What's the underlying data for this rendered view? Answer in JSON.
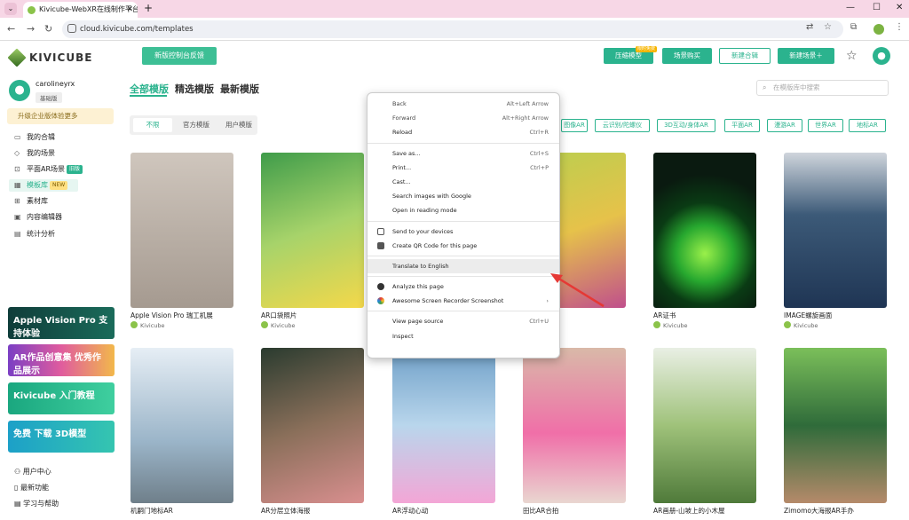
{
  "browser": {
    "tab_title": "Kivicube-WebXR在线制作平台",
    "url": "cloud.kivicube.com/templates"
  },
  "header": {
    "logo": "KIVICUBE",
    "feedback": "新版控制台反馈",
    "buttons": [
      "压缩模型",
      "场景购买",
      "新建合辑",
      "新建场景＋"
    ],
    "hot": "限时免费"
  },
  "sidebar": {
    "username": "carolineyrx",
    "badge": "基础版",
    "upgrade": "升级企业版体验更多",
    "items": [
      {
        "label": "我的合辑",
        "icon": "folder"
      },
      {
        "label": "我的场景",
        "icon": "cube"
      },
      {
        "label": "平面AR场景",
        "icon": "ar",
        "tag": "旧版"
      },
      {
        "label": "模板库",
        "icon": "template",
        "tag": "NEW"
      },
      {
        "label": "素材库",
        "icon": "material"
      },
      {
        "label": "内容编辑器",
        "icon": "editor"
      },
      {
        "label": "统计分析",
        "icon": "stats"
      }
    ],
    "banners": [
      "Apple Vision Pro 支持体验",
      "AR作品创意集 优秀作品展示",
      "Kivicube 入门教程",
      "免费 下载 3D模型"
    ],
    "footer": [
      "用户中心",
      "最新功能",
      "学习与帮助"
    ]
  },
  "main": {
    "tabs": [
      "全部模版",
      "精选模版",
      "最新模版"
    ],
    "search_placeholder": "在模版库中搜索",
    "segments": [
      "不限",
      "官方模版",
      "用户模版"
    ],
    "filter_tags": [
      "图像AR",
      "云识别/陀螺仪",
      "3D互动/身体AR",
      "平面AR",
      "漫游AR",
      "世界AR",
      "地标AR"
    ],
    "cards": [
      {
        "title": "Apple Vision Pro 瑞工机展",
        "author": "Kivicube"
      },
      {
        "title": "AR口袋照片",
        "author": "Kivicube"
      },
      {
        "title": "",
        "author": ""
      },
      {
        "title": "",
        "author": ""
      },
      {
        "title": "AR证书",
        "author": "Kivicube"
      },
      {
        "title": "IMAGE螺旋画面",
        "author": "Kivicube"
      },
      {
        "title": "机嗣门地标AR",
        "author": ""
      },
      {
        "title": "AR分层立体海报",
        "author": ""
      },
      {
        "title": "AR浮动心动",
        "author": ""
      },
      {
        "title": "田比AR合拍",
        "author": ""
      },
      {
        "title": "AR画册-山坡上的小木屋",
        "author": ""
      },
      {
        "title": "Zimomo大海报AR手办",
        "author": ""
      }
    ]
  },
  "context_menu": {
    "items": [
      {
        "label": "Back",
        "shortcut": "Alt+Left Arrow"
      },
      {
        "label": "Forward",
        "shortcut": "Alt+Right Arrow"
      },
      {
        "label": "Reload",
        "shortcut": "Ctrl+R"
      },
      {
        "label": "Save as...",
        "shortcut": "Ctrl+S"
      },
      {
        "label": "Print...",
        "shortcut": "Ctrl+P"
      },
      {
        "label": "Cast...",
        "shortcut": ""
      },
      {
        "label": "Search images with Google",
        "shortcut": ""
      },
      {
        "label": "Open in reading mode",
        "shortcut": ""
      },
      {
        "label": "Send to your devices",
        "shortcut": ""
      },
      {
        "label": "Create QR Code for this page",
        "shortcut": ""
      },
      {
        "label": "Translate to English",
        "shortcut": ""
      },
      {
        "label": "Analyze this page",
        "shortcut": ""
      },
      {
        "label": "Awesome Screen Recorder  Screenshot",
        "shortcut": "›"
      },
      {
        "label": "View page source",
        "shortcut": "Ctrl+U"
      },
      {
        "label": "Inspect",
        "shortcut": ""
      }
    ]
  },
  "colors": {
    "accent": "#2bb38e",
    "tab_bar": "#f7d7e6",
    "arrow": "#e53935"
  }
}
